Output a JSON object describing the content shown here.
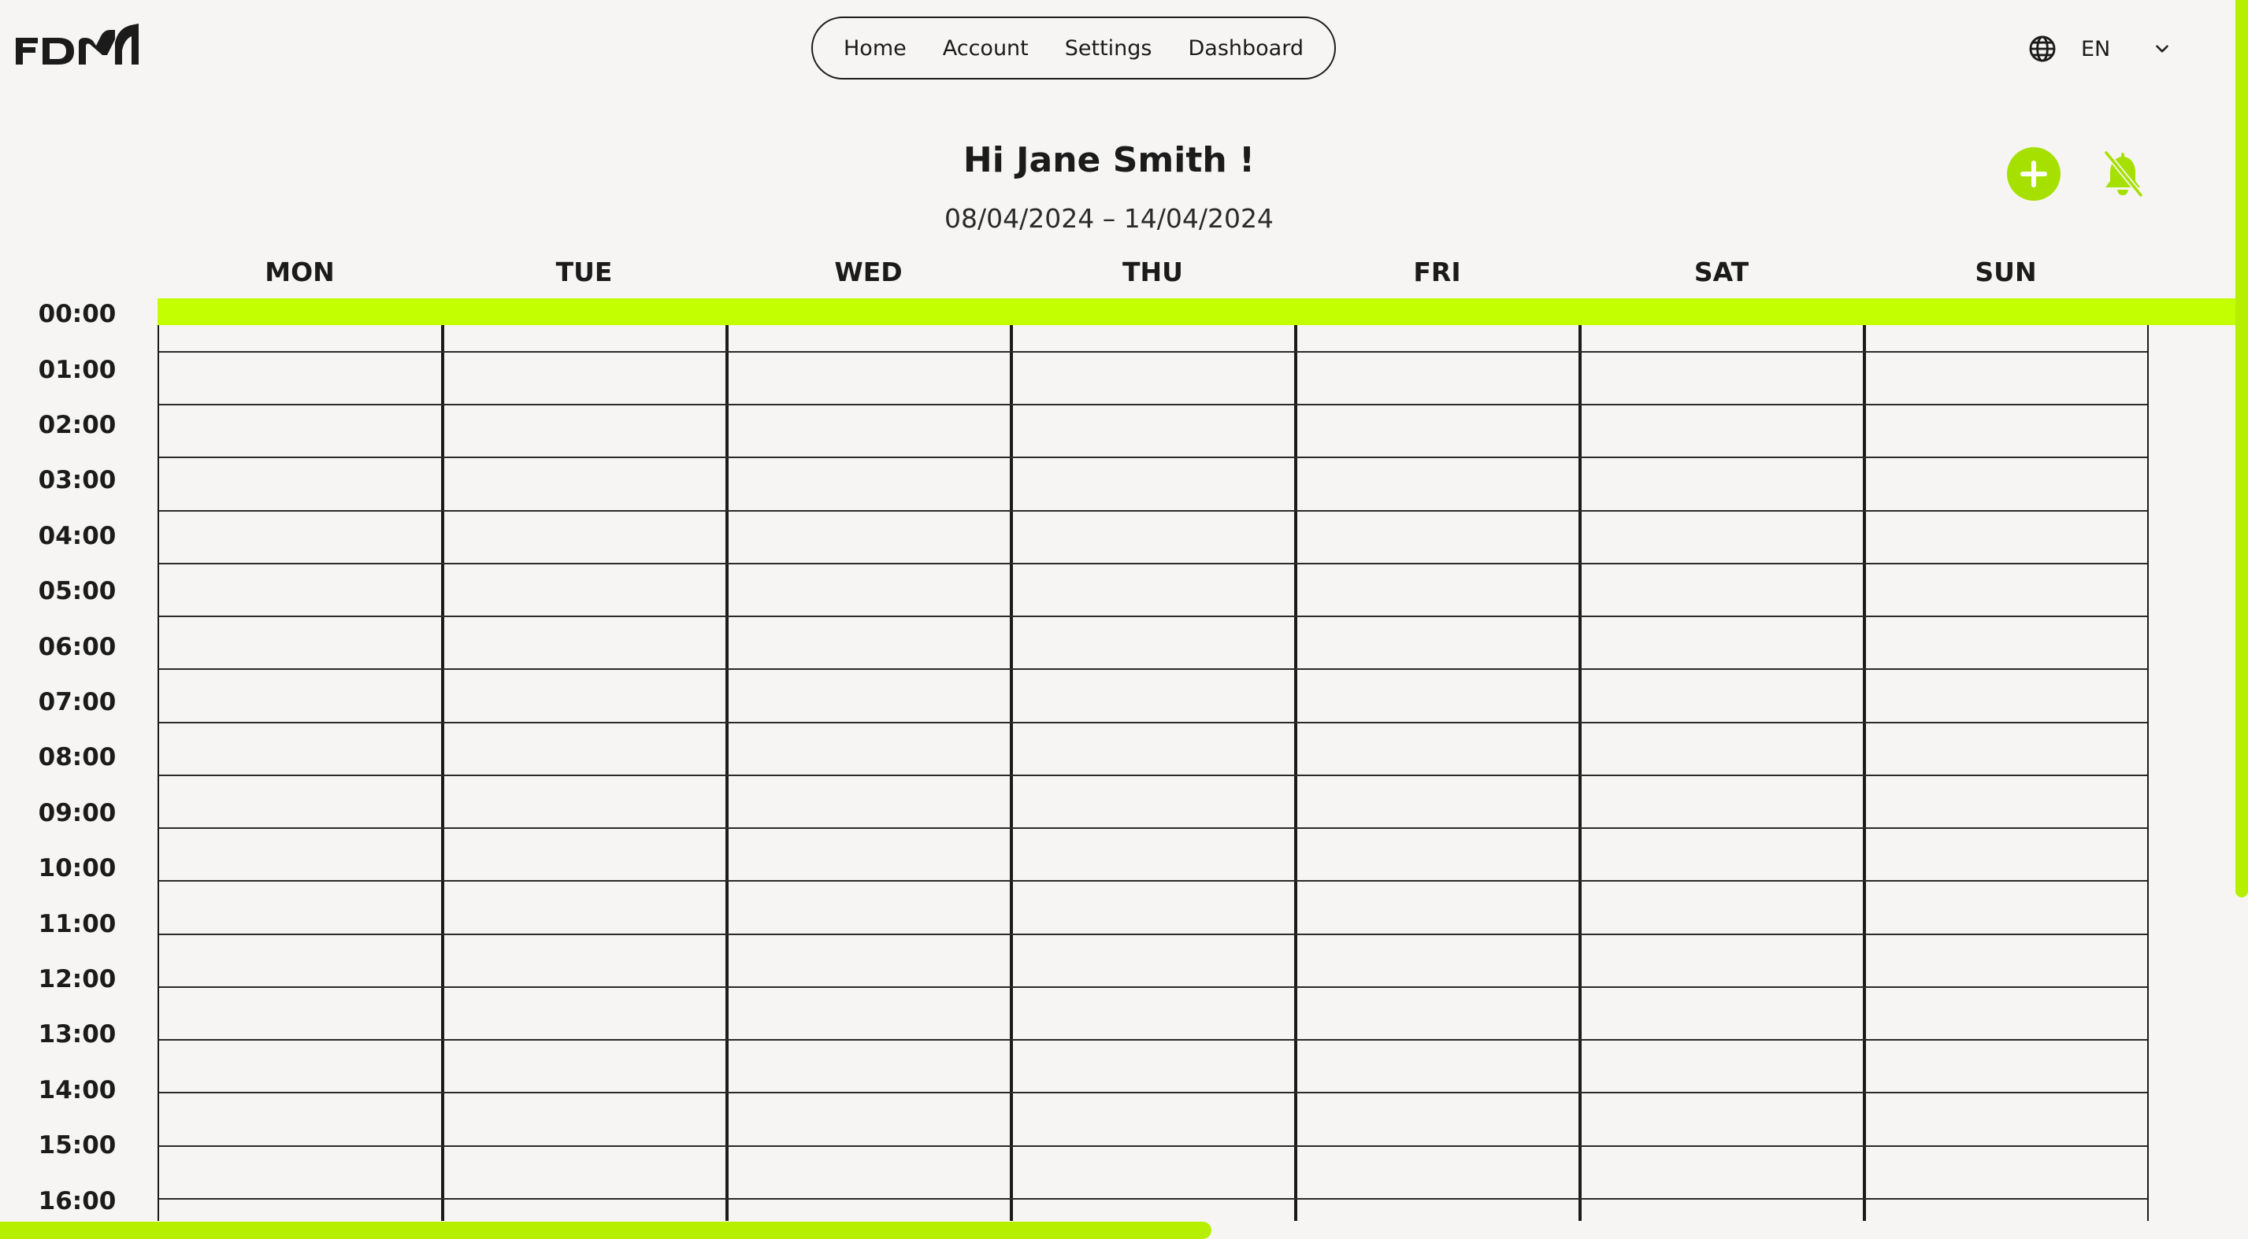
{
  "brand": {
    "logo_text": "FDM"
  },
  "nav": {
    "items": [
      "Home",
      "Account",
      "Settings",
      "Dashboard"
    ]
  },
  "language": {
    "code": "EN",
    "icon": "globe-icon",
    "dropdown_icon": "chevron-down-icon"
  },
  "greeting": "Hi Jane Smith !",
  "week_range": "08/04/2024 – 14/04/2024",
  "actions": {
    "add_icon": "plus-circle-icon",
    "notifications_icon": "bell-off-icon"
  },
  "calendar": {
    "days": [
      "MON",
      "TUE",
      "WED",
      "THU",
      "FRI",
      "SAT",
      "SUN"
    ],
    "hours": [
      "00:00",
      "01:00",
      "02:00",
      "03:00",
      "04:00",
      "05:00",
      "06:00",
      "07:00",
      "08:00",
      "09:00",
      "10:00",
      "11:00",
      "12:00",
      "13:00",
      "14:00",
      "15:00",
      "16:00"
    ]
  },
  "colors": {
    "accent": "#c4ff00",
    "accent_button": "#a6e000",
    "background": "#f6f5f3",
    "text": "#1b1b1b"
  }
}
